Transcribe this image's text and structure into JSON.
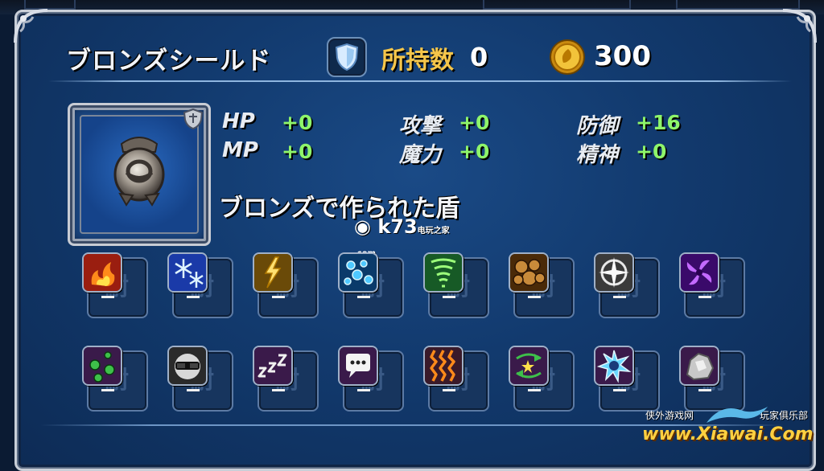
{
  "item": {
    "name": "ブロンズシールド",
    "description": "ブロンズで作られた盾",
    "owned_label": "所持数",
    "owned_count": "0",
    "price": "300"
  },
  "stats": [
    {
      "label": "HP",
      "value": "+0"
    },
    {
      "label": "MP",
      "value": "+0"
    },
    {
      "label": "攻撃",
      "value": "+0"
    },
    {
      "label": "魔力",
      "value": "+0"
    },
    {
      "label": "防御",
      "value": "+16"
    },
    {
      "label": "精神",
      "value": "+0"
    }
  ],
  "resistances": {
    "slot_glyph": "耐",
    "elements": [
      {
        "icon": "fire-icon",
        "value": "–"
      },
      {
        "icon": "ice-icon",
        "value": "–"
      },
      {
        "icon": "thunder-icon",
        "value": "–"
      },
      {
        "icon": "water-icon",
        "value": "–"
      },
      {
        "icon": "wind-icon",
        "value": "–"
      },
      {
        "icon": "earth-icon",
        "value": "–"
      },
      {
        "icon": "holy-icon",
        "value": "–"
      },
      {
        "icon": "dark-icon",
        "value": "–"
      }
    ],
    "ailments": [
      {
        "icon": "poison-icon",
        "value": "–"
      },
      {
        "icon": "blind-icon",
        "value": "–"
      },
      {
        "icon": "sleep-icon",
        "value": "–"
      },
      {
        "icon": "silence-icon",
        "value": "–"
      },
      {
        "icon": "paralysis-icon",
        "value": "–"
      },
      {
        "icon": "confusion-icon",
        "value": "–"
      },
      {
        "icon": "slow-icon",
        "value": "–"
      },
      {
        "icon": "stone-icon",
        "value": "–"
      }
    ]
  },
  "watermarks": {
    "k73": "k73",
    "k73_sub": "电玩之家",
    "k73_com": ".com",
    "site_left": "侠外游戏网",
    "site_right": "玩家俱乐部",
    "site_url": "www.Xiawai.Com"
  },
  "colors": {
    "panel_bg": "#123a6e",
    "owned_label": "#f5c64a",
    "stat_value": "#8ef56a",
    "text": "#f2f4f8"
  }
}
